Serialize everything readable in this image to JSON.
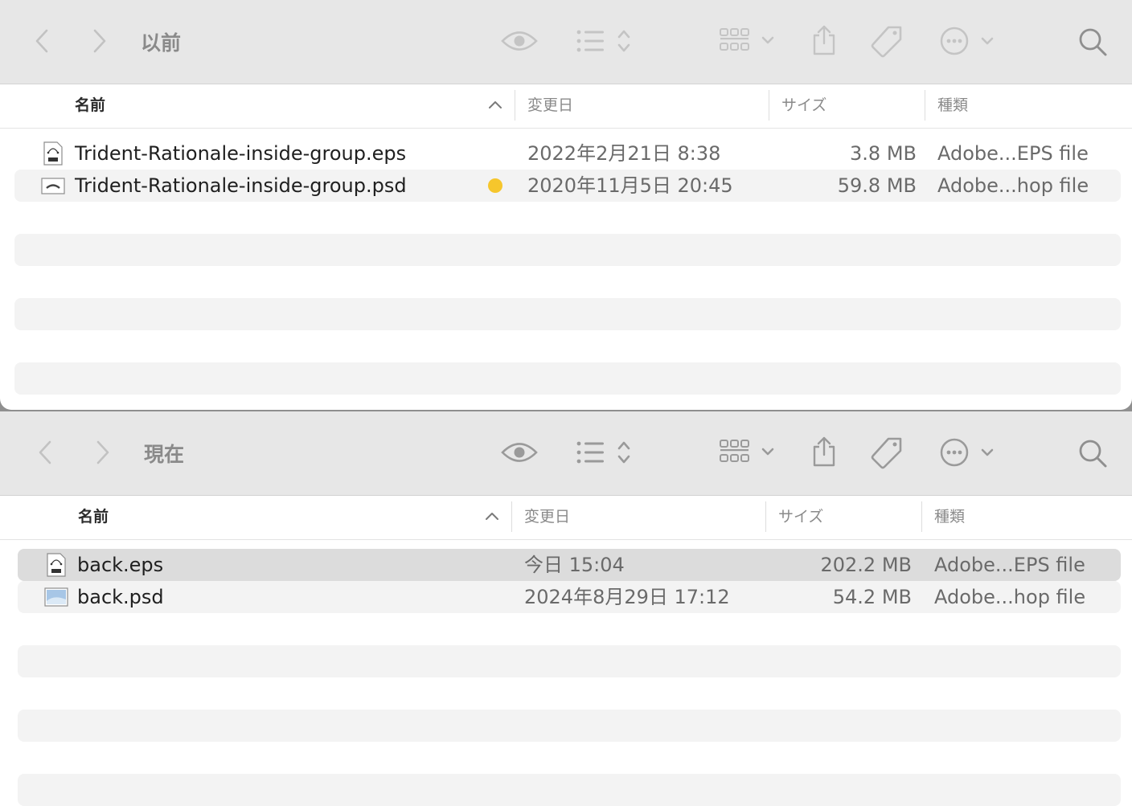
{
  "common": {
    "columns": {
      "name": "名前",
      "date": "変更日",
      "size": "サイズ",
      "kind": "種類"
    },
    "icons": [
      "back-icon",
      "forward-icon",
      "eye-icon",
      "list-view-icon",
      "grid-view-icon",
      "share-icon",
      "tag-icon",
      "more-icon",
      "search-icon"
    ],
    "tag_color": "#f6c62c"
  },
  "top_window": {
    "title": "以前",
    "files": [
      {
        "name": "Trident-Rationale-inside-group.eps",
        "date": "2022年2月21日 8:38",
        "size": "3.8 MB",
        "kind": "Adobe...EPS file",
        "icon": "eps-file-icon"
      },
      {
        "name": "Trident-Rationale-inside-group.psd",
        "date": "2020年11月5日 20:45",
        "size": "59.8 MB",
        "kind": "Adobe...hop file",
        "icon": "psd-file-icon",
        "tag": "yellow"
      }
    ]
  },
  "bottom_window": {
    "title": "現在",
    "files": [
      {
        "name": "back.eps",
        "date": "今日 15:04",
        "size": "202.2 MB",
        "kind": "Adobe...EPS file",
        "icon": "eps-file-icon",
        "selected": true
      },
      {
        "name": "back.psd",
        "date": "2024年8月29日 17:12",
        "size": "54.2 MB",
        "kind": "Adobe...hop file",
        "icon": "psd-file-icon"
      }
    ]
  }
}
